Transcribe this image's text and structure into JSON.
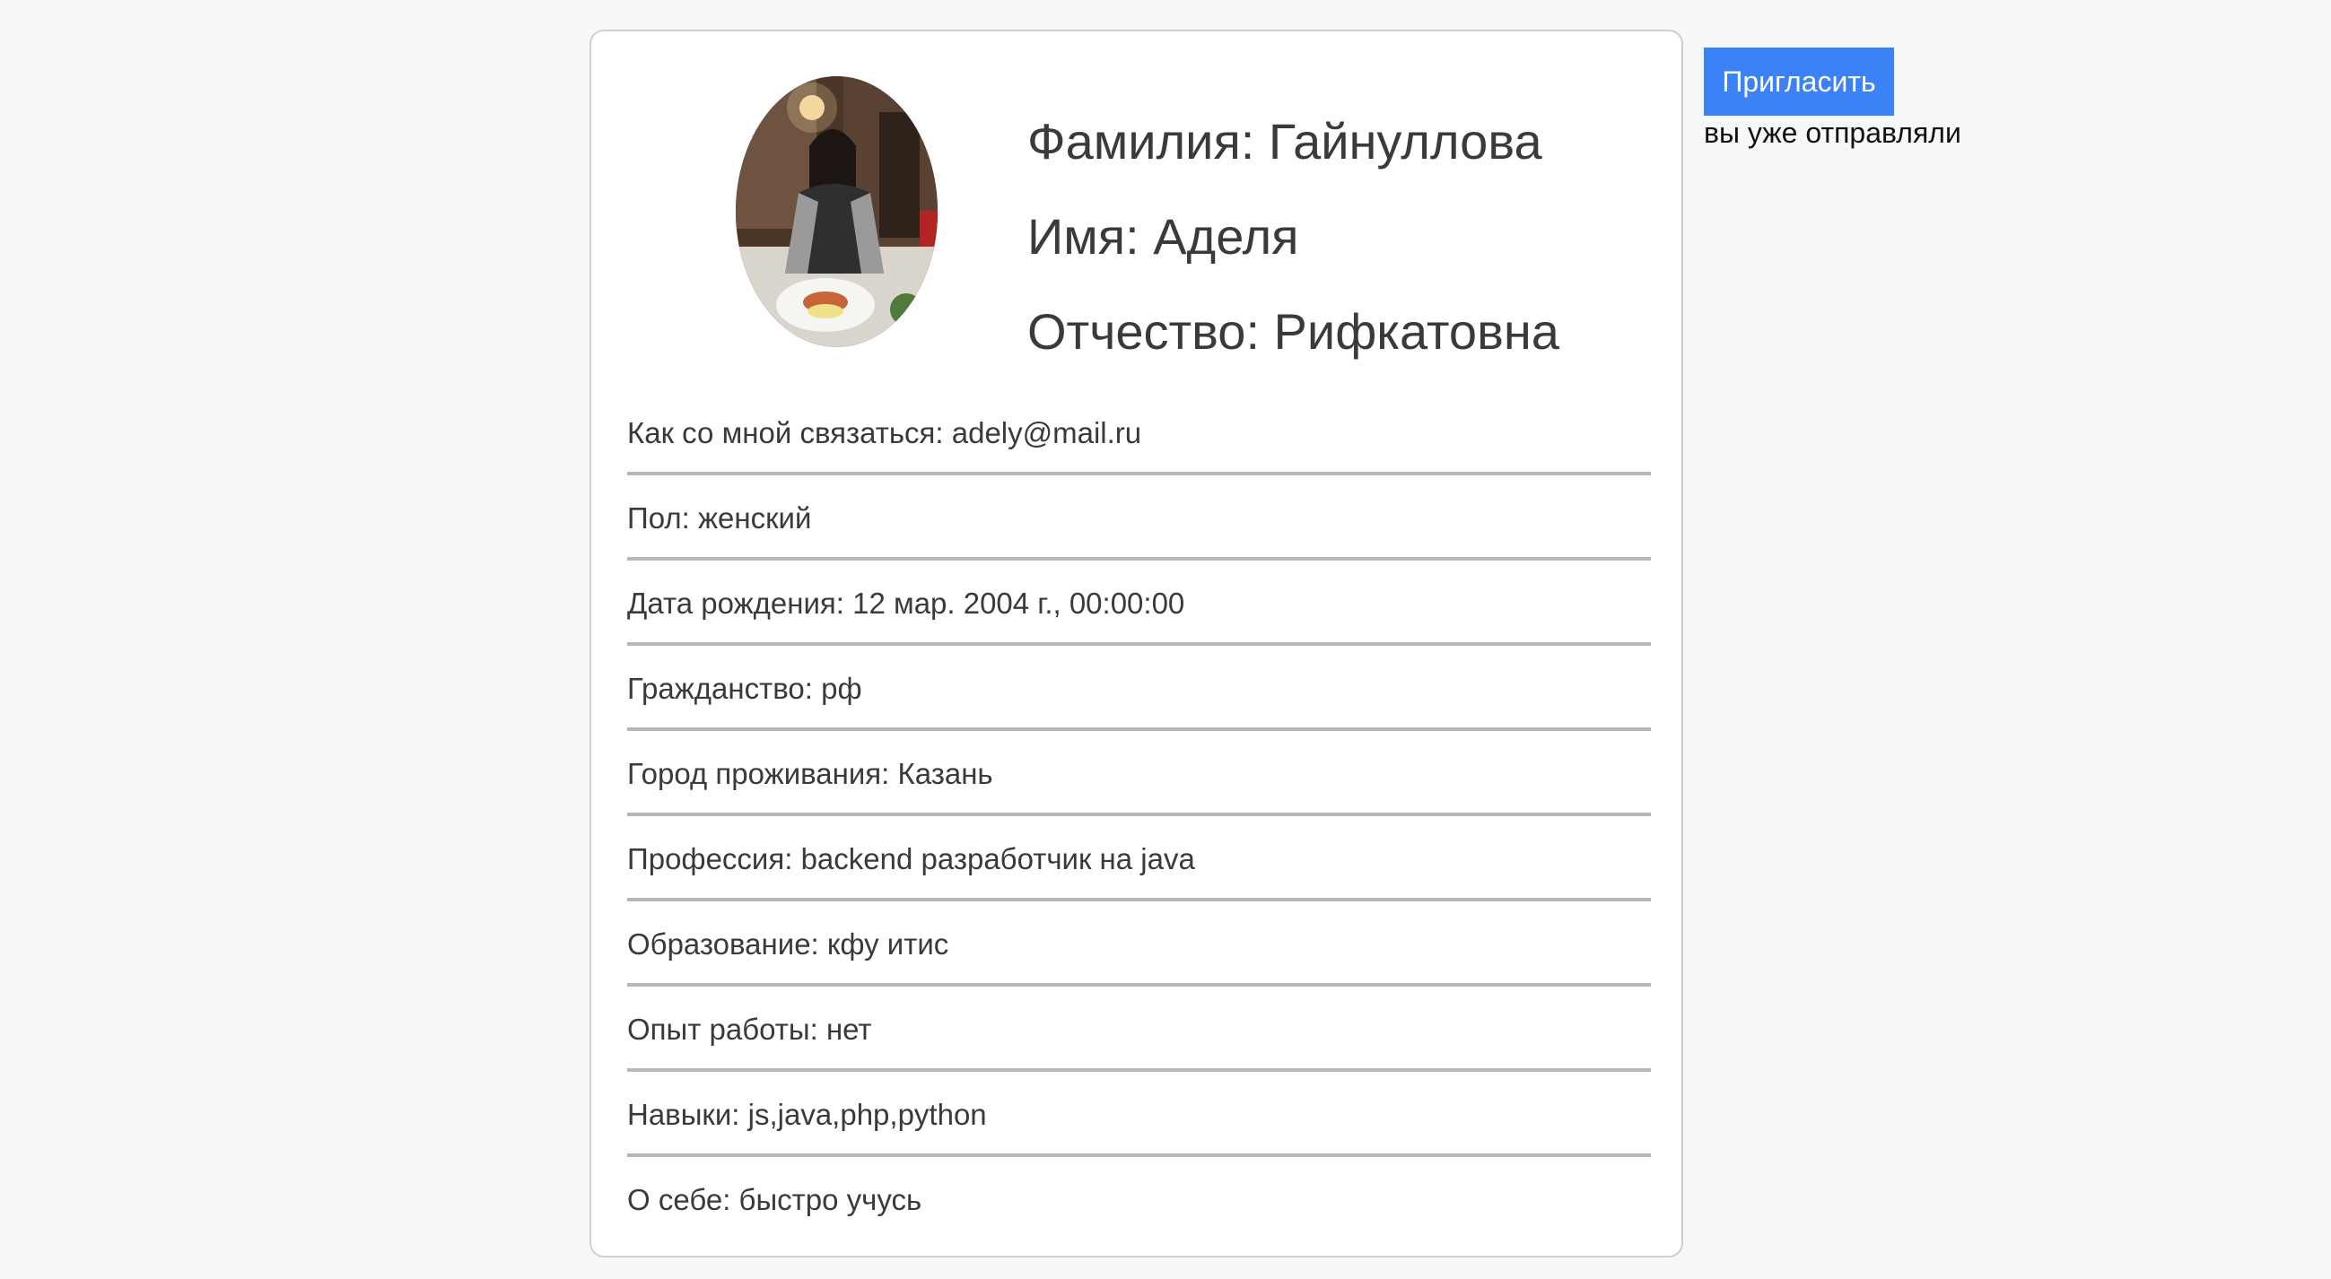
{
  "profile": {
    "last_name": "Фамилия: Гайнуллова",
    "first_name": "Имя: Аделя",
    "patronymic": "Отчество: Рифкатовна",
    "fields": [
      "Как со мной связаться: adely@mail.ru",
      "Пол: женский",
      "Дата рождения: 12 мар. 2004 г., 00:00:00",
      "Гражданство: рф",
      "Город проживания: Казань",
      "Профессия: backend разработчик на java",
      "Образование: кфу итис",
      "Опыт работы: нет",
      "Навыки: js,java,php,python",
      "О себе: быстро учусь"
    ]
  },
  "actions": {
    "invite_label": "Пригласить",
    "status_note": "вы уже отправляли"
  },
  "colors": {
    "accent": "#3b82f6",
    "divider": "#b7b7b7",
    "background": "#f7f8fa"
  }
}
